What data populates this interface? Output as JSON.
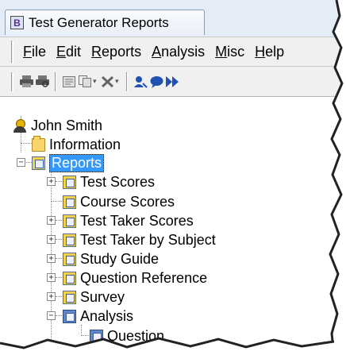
{
  "window": {
    "title": "Test Generator Reports",
    "icon_letter": "B"
  },
  "menu": [
    {
      "label": "File",
      "ul": "F",
      "rest": "ile"
    },
    {
      "label": "Edit",
      "ul": "E",
      "rest": "dit"
    },
    {
      "label": "Reports",
      "ul": "R",
      "rest": "eports"
    },
    {
      "label": "Analysis",
      "ul": "A",
      "rest": "nalysis"
    },
    {
      "label": "Misc",
      "ul": "M",
      "rest": "isc"
    },
    {
      "label": "Help",
      "ul": "H",
      "rest": "elp"
    }
  ],
  "toolbar_icons": [
    "print-icon",
    "print-preview-icon",
    "report-icon",
    "copy-icon",
    "tools-icon",
    "user-search-icon",
    "chat-icon",
    "forward-icon"
  ],
  "tree": {
    "root": "John Smith",
    "information": "Information",
    "reports": "Reports",
    "report_items": [
      "Test Scores",
      "Course Scores",
      "Test Taker Scores",
      "Test Taker by Subject",
      "Study Guide",
      "Question Reference",
      "Survey",
      "Analysis"
    ],
    "analysis_child": "Question"
  },
  "colors": {
    "selection": "#3399ff",
    "chrome": "#f0f0f0",
    "title_bar": "#e3ecf7"
  }
}
